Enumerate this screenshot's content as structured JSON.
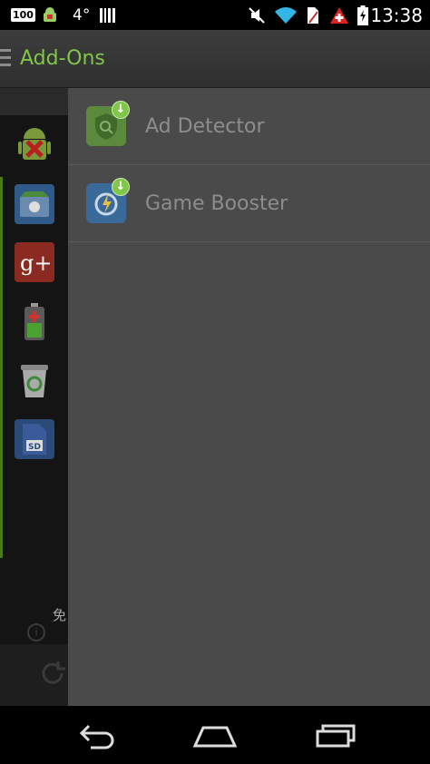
{
  "status_bar": {
    "battery_badge": "100",
    "temperature": "4°",
    "time": "13:38",
    "icons": [
      "battery-100-badge",
      "android-debug-icon",
      "barcode-icon",
      "mute-icon",
      "wifi-icon",
      "sim-icon",
      "alert-icon",
      "battery-icon"
    ]
  },
  "action_bar": {
    "title": "Add-Ons",
    "accent_color": "#7fc64a"
  },
  "left_pane": {
    "partial_text": "免",
    "apps": [
      "android-x-icon",
      "store-icon",
      "google-plus-icon",
      "battery-app-icon",
      "recycle-bin-icon",
      "sd-card-icon"
    ]
  },
  "addons": [
    {
      "label": "Ad Detector",
      "icon": "ad-detector-icon",
      "badge": "download-badge-icon"
    },
    {
      "label": "Game Booster",
      "icon": "game-booster-icon",
      "badge": "download-badge-icon"
    }
  ],
  "nav_bar": {
    "buttons": [
      "back-icon",
      "home-icon",
      "recents-icon"
    ]
  }
}
